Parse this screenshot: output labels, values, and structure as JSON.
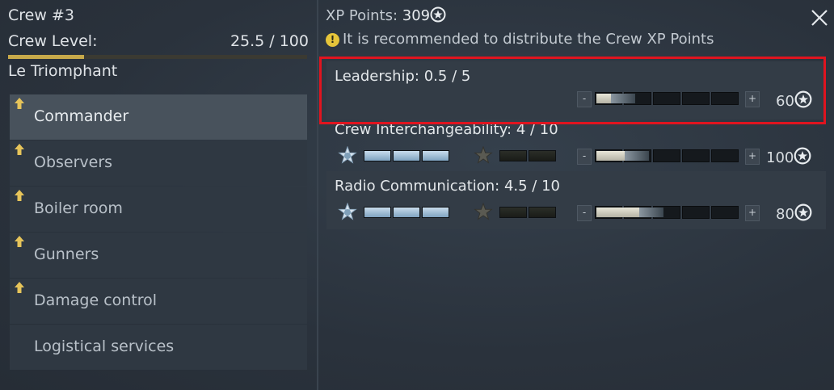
{
  "crew": {
    "title": "Crew #3",
    "level_label": "Crew Level:",
    "level_value": "25.5 / 100",
    "level_progress": 0.255,
    "ship_name": "Le Triomphant"
  },
  "menu": [
    {
      "label": "Commander",
      "active": true,
      "upgrade_arrow": true
    },
    {
      "label": "Observers",
      "active": false,
      "upgrade_arrow": true
    },
    {
      "label": "Boiler room",
      "active": false,
      "upgrade_arrow": true
    },
    {
      "label": "Gunners",
      "active": false,
      "upgrade_arrow": true
    },
    {
      "label": "Damage control",
      "active": false,
      "upgrade_arrow": true
    },
    {
      "label": "Logistical services",
      "active": false,
      "upgrade_arrow": false
    }
  ],
  "xp": {
    "label": "XP Points:",
    "value": "309",
    "warning": "It is recommended to distribute the Crew XP Points"
  },
  "skills": [
    {
      "name": "Leadership: 0.5 / 5",
      "cost": "60",
      "level": 0.5,
      "max": 5,
      "has_ranks": false
    },
    {
      "name": "Crew Interchangeability: 4 / 10",
      "cost": "100",
      "level": 4,
      "max": 10,
      "has_ranks": true
    },
    {
      "name": "Radio Communication: 4.5 / 10",
      "cost": "80",
      "level": 4.5,
      "max": 10,
      "has_ranks": true
    }
  ],
  "colors": {
    "accent_gold": "#c7a94a",
    "highlight_red": "#e0141f"
  },
  "icons": {
    "close": "close-icon",
    "warning": "warning-icon",
    "xp_star": "star-circle-icon",
    "upgrade": "upgrade-arrow-icon"
  }
}
